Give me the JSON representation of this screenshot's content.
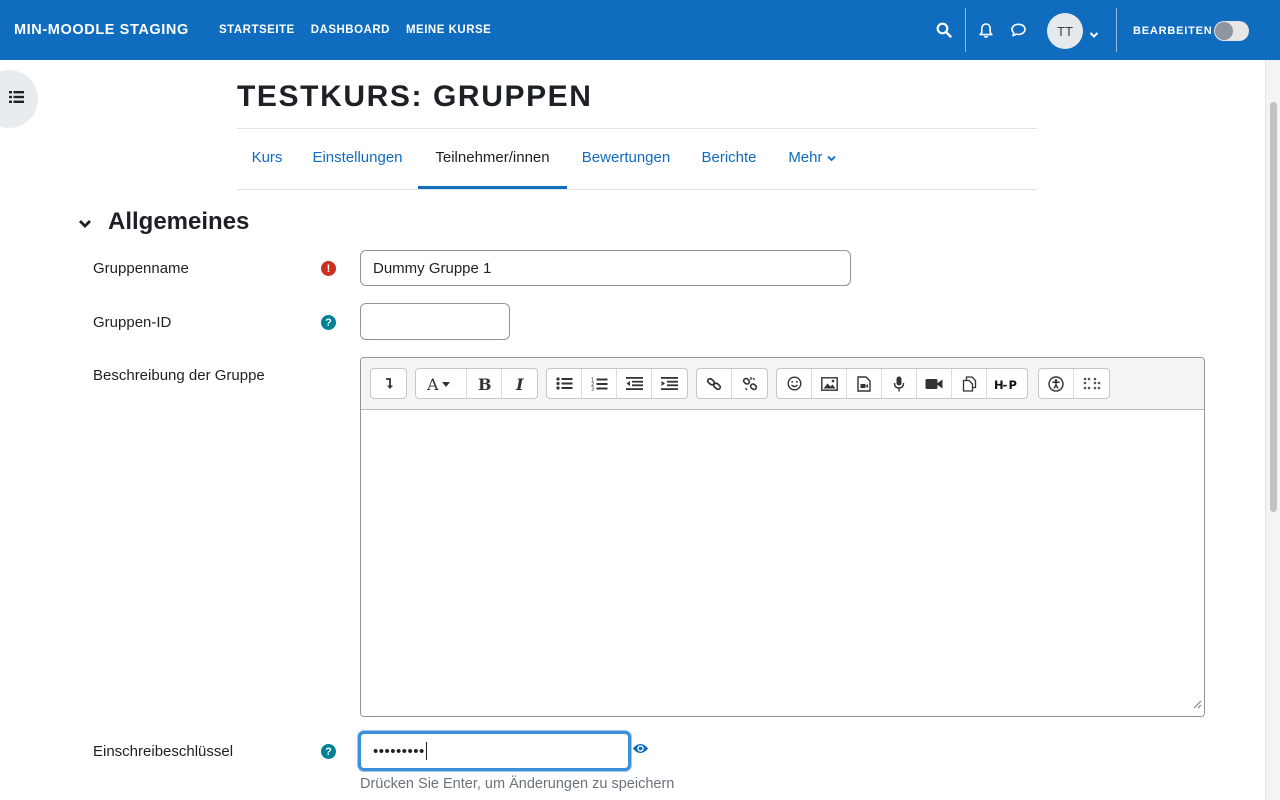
{
  "navbar": {
    "brand": "MIN-MOODLE STAGING",
    "links": [
      "STARTSEITE",
      "DASHBOARD",
      "MEINE KURSE"
    ],
    "avatar_initials": "TT",
    "edit_mode_label": "BEARBEITEN",
    "edit_mode_on": false,
    "icons": [
      "search-icon",
      "bell-icon",
      "chat-icon"
    ]
  },
  "page": {
    "title": "TESTKURS: GRUPPEN",
    "tabs": [
      {
        "label": "Kurs",
        "active": false
      },
      {
        "label": "Einstellungen",
        "active": false
      },
      {
        "label": "Teilnehmer/innen",
        "active": true
      },
      {
        "label": "Bewertungen",
        "active": false
      },
      {
        "label": "Berichte",
        "active": false
      },
      {
        "label": "Mehr",
        "active": false
      }
    ]
  },
  "form": {
    "section_title": "Allgemeines",
    "group_name": {
      "label": "Gruppenname",
      "value": "Dummy Gruppe 1"
    },
    "group_id": {
      "label": "Gruppen-ID",
      "value": ""
    },
    "description": {
      "label": "Beschreibung der Gruppe"
    },
    "enrolment_key": {
      "label": "Einschreibeschlüssel",
      "value": "•••••••••",
      "hint": "Drücken Sie Enter, um Änderungen zu speichern"
    }
  },
  "editor_toolbar_icons": [
    [
      "collapse-icon"
    ],
    [
      "font-style-icon",
      "bold-icon",
      "italic-icon"
    ],
    [
      "unordered-list-icon",
      "ordered-list-icon",
      "outdent-icon",
      "indent-icon"
    ],
    [
      "link-icon",
      "unlink-icon"
    ],
    [
      "emoji-icon",
      "image-icon",
      "media-icon",
      "record-audio-icon",
      "record-video-icon",
      "manage-files-icon",
      "h5p-icon"
    ],
    [
      "accessibility-checker-icon",
      "screenreader-helper-icon"
    ]
  ],
  "colors": {
    "brand": "#0f6cbf",
    "required": "#ca3120",
    "help": "#008196"
  }
}
